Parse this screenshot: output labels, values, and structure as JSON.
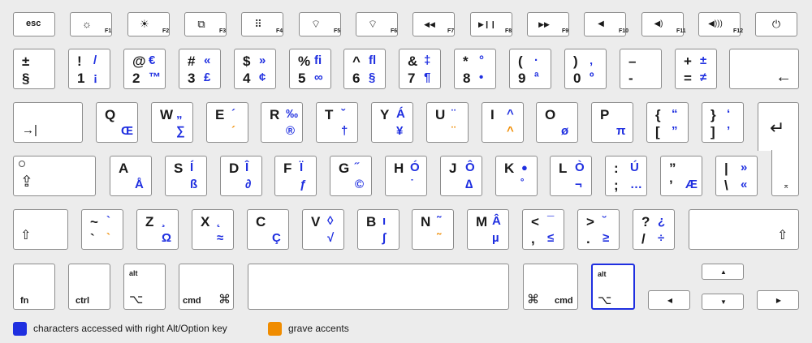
{
  "colors": {
    "alt": "#1f2fe0",
    "grave": "#f08c00",
    "key_border": "#8c8c8c",
    "background": "#ececec"
  },
  "legend": {
    "alt": "characters accessed with right Alt/Option key",
    "grave": "grave accents"
  },
  "function_row": [
    {
      "id": "esc",
      "label": "esc"
    },
    {
      "id": "f1",
      "icon": "brightness-down-icon",
      "glyph": "☼",
      "fn": "F1"
    },
    {
      "id": "f2",
      "icon": "brightness-up-icon",
      "glyph": "☀",
      "fn": "F2"
    },
    {
      "id": "f3",
      "icon": "mission-control-icon",
      "glyph": "⧉",
      "fn": "F3"
    },
    {
      "id": "f4",
      "icon": "launchpad-icon",
      "glyph": "⠿",
      "fn": "F4"
    },
    {
      "id": "f5",
      "icon": "keyboard-light-down-icon",
      "glyph": "⌔",
      "fn": "F5"
    },
    {
      "id": "f6",
      "icon": "keyboard-light-up-icon",
      "glyph": "⌔",
      "fn": "F6"
    },
    {
      "id": "f7",
      "icon": "rewind-icon",
      "glyph": "◀◀",
      "fn": "F7"
    },
    {
      "id": "f8",
      "icon": "play-pause-icon",
      "glyph": "▶❙❙",
      "fn": "F8"
    },
    {
      "id": "f9",
      "icon": "fast-forward-icon",
      "glyph": "▶▶",
      "fn": "F9"
    },
    {
      "id": "f10",
      "icon": "mute-icon",
      "glyph": "◀",
      "fn": "F10"
    },
    {
      "id": "f11",
      "icon": "volume-down-icon",
      "glyph": "◀)",
      "fn": "F11"
    },
    {
      "id": "f12",
      "icon": "volume-up-icon",
      "glyph": "◀)))",
      "fn": "F12"
    },
    {
      "id": "power",
      "icon": "power-icon",
      "glyph": "⏻"
    }
  ],
  "rows": [
    [
      {
        "id": "section",
        "tl": "±",
        "bl": "§"
      },
      {
        "id": "1",
        "tl": "!",
        "bl": "1",
        "tr": "/",
        "br": "¡"
      },
      {
        "id": "2",
        "tl": "@",
        "bl": "2",
        "tr": "€",
        "br": "™"
      },
      {
        "id": "3",
        "tl": "#",
        "bl": "3",
        "tr": "«",
        "br": "£"
      },
      {
        "id": "4",
        "tl": "$",
        "bl": "4",
        "tr": "»",
        "br": "¢"
      },
      {
        "id": "5",
        "tl": "%",
        "bl": "5",
        "tr": "ﬁ",
        "br": "∞"
      },
      {
        "id": "6",
        "tl": "^",
        "bl": "6",
        "tr": "ﬂ",
        "br": "§"
      },
      {
        "id": "7",
        "tl": "&",
        "bl": "7",
        "tr": "‡",
        "br": "¶"
      },
      {
        "id": "8",
        "tl": "*",
        "bl": "8",
        "tr": "°",
        "br": "•"
      },
      {
        "id": "9",
        "tl": "(",
        "bl": "9",
        "tr": "·",
        "br": "ª"
      },
      {
        "id": "0",
        "tl": ")",
        "bl": "0",
        "tr": "‚",
        "br": "º"
      },
      {
        "id": "minus",
        "tl": "–",
        "bl": "-"
      },
      {
        "id": "equal",
        "tl": "+",
        "bl": "=",
        "tr": "±",
        "br": "≠"
      },
      {
        "id": "backspace",
        "icon": "backspace-icon",
        "glyph": "←"
      }
    ],
    [
      {
        "id": "tab",
        "icon": "tab-icon",
        "glyph": "→|"
      },
      {
        "id": "q",
        "tl": "Q",
        "br": "Œ"
      },
      {
        "id": "w",
        "tl": "W",
        "tr": "„",
        "br": "∑"
      },
      {
        "id": "e",
        "tl": "E",
        "tr": "´",
        "brg": "´"
      },
      {
        "id": "r",
        "tl": "R",
        "tr": "‰",
        "br": "®"
      },
      {
        "id": "t",
        "tl": "T",
        "tr": "ˇ",
        "br": "†"
      },
      {
        "id": "y",
        "tl": "Y",
        "tr": "Á",
        "br": "¥"
      },
      {
        "id": "u",
        "tl": "U",
        "tr": "¨",
        "brg": "¨"
      },
      {
        "id": "i",
        "tl": "I",
        "tr": "^",
        "brg": "^"
      },
      {
        "id": "o",
        "tl": "O",
        "br": "ø"
      },
      {
        "id": "p",
        "tl": "P",
        "br": "π"
      },
      {
        "id": "bracket_l",
        "tl": "{",
        "bl": "[",
        "tr": "“",
        "br": "”"
      },
      {
        "id": "bracket_r",
        "tl": "}",
        "bl": "]",
        "tr": "‘",
        "br": "’"
      }
    ],
    [
      {
        "id": "caps",
        "icon": "caps-lock-icon",
        "glyph": "⇪"
      },
      {
        "id": "a",
        "tl": "A",
        "br": "Å"
      },
      {
        "id": "s",
        "tl": "S",
        "tr": "Í",
        "br": "ß"
      },
      {
        "id": "d",
        "tl": "D",
        "tr": "Î",
        "br": "∂"
      },
      {
        "id": "f",
        "tl": "F",
        "tr": "Ï",
        "br": "ƒ"
      },
      {
        "id": "g",
        "tl": "G",
        "tr": "˝",
        "br": "©"
      },
      {
        "id": "h",
        "tl": "H",
        "tr": "Ó",
        "br": "˙"
      },
      {
        "id": "j",
        "tl": "J",
        "tr": "Ô",
        "br": "∆"
      },
      {
        "id": "k",
        "tl": "K",
        "tr": "",
        "br": "˚"
      },
      {
        "id": "l",
        "tl": "L",
        "tr": "Ò",
        "br": "¬"
      },
      {
        "id": "semicolon",
        "tl": ":",
        "bl": ";",
        "tr": "Ú",
        "br": "…"
      },
      {
        "id": "quote",
        "tl": "”",
        "bl": "’",
        "br": "Æ"
      },
      {
        "id": "backslash",
        "tl": "|",
        "bl": "\\",
        "tr": "»",
        "br": "«"
      }
    ],
    [
      {
        "id": "shift_l",
        "icon": "shift-icon",
        "glyph": "⇧"
      },
      {
        "id": "tilde",
        "tl": "~",
        "bl": "`",
        "tr": "`",
        "brg": "`"
      },
      {
        "id": "z",
        "tl": "Z",
        "tr": "¸",
        "br": "Ω"
      },
      {
        "id": "x",
        "tl": "X",
        "tr": "˛",
        "br": "≈"
      },
      {
        "id": "c",
        "tl": "C",
        "br": "Ç"
      },
      {
        "id": "v",
        "tl": "V",
        "tr": "◊",
        "br": "√"
      },
      {
        "id": "b",
        "tl": "B",
        "tr": "ı",
        "br": "∫"
      },
      {
        "id": "n",
        "tl": "N",
        "tr": "˜",
        "brg": "˜"
      },
      {
        "id": "m",
        "tl": "M",
        "tr": "Â",
        "br": "µ"
      },
      {
        "id": "comma",
        "tl": "<",
        "bl": ",",
        "tr": "¯",
        "br": "≤"
      },
      {
        "id": "period",
        "tl": ">",
        "bl": ".",
        "tr": "˘",
        "br": "≥"
      },
      {
        "id": "slash",
        "tl": "?",
        "bl": "/",
        "tr": "¿",
        "br": "÷"
      },
      {
        "id": "shift_r",
        "icon": "shift-icon",
        "glyph": "⇧"
      }
    ]
  ],
  "bottom_row": [
    {
      "id": "fn",
      "label": "fn"
    },
    {
      "id": "ctrl",
      "label": "ctrl"
    },
    {
      "id": "alt_l",
      "label": "alt",
      "icon": "option-icon",
      "glyph": "⌥"
    },
    {
      "id": "cmd_l",
      "label": "cmd",
      "icon": "command-icon",
      "glyph": "⌘"
    },
    {
      "id": "space"
    },
    {
      "id": "cmd_r",
      "label": "cmd",
      "icon": "command-icon",
      "glyph": "⌘"
    },
    {
      "id": "alt_r",
      "label": "alt",
      "icon": "option-icon",
      "glyph": "⌥",
      "selected": true
    },
    {
      "id": "arrow_left",
      "icon": "arrow-left-icon",
      "glyph": "◀"
    },
    {
      "id": "arrow_up",
      "icon": "arrow-up-icon",
      "glyph": "▲"
    },
    {
      "id": "arrow_down",
      "icon": "arrow-down-icon",
      "glyph": "▼"
    },
    {
      "id": "arrow_right",
      "icon": "arrow-right-icon",
      "glyph": "▶"
    }
  ],
  "enter": {
    "id": "enter",
    "icon": "return-icon",
    "glyph": "↵",
    "corner_glyph": "⌅"
  }
}
